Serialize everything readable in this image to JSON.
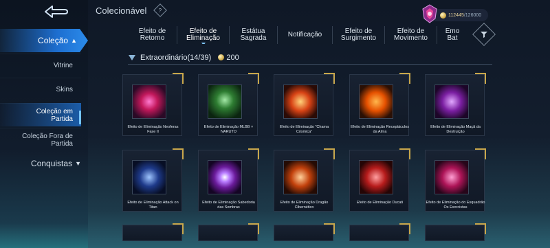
{
  "header": {
    "back_icon": "back-arrow-icon",
    "title": "Colecionável",
    "help_icon": "help-question-icon",
    "currency_current": "112445",
    "currency_max": "/126000"
  },
  "sidebar": {
    "main": "Coleção",
    "items": [
      {
        "label": "Vitrine"
      },
      {
        "label": "Skins"
      },
      {
        "label": "Coleção em Partida"
      },
      {
        "label": "Coleção Fora de Partida"
      }
    ],
    "conquistas": "Conquistas"
  },
  "tabs": [
    {
      "label": "Efeito de Retorno"
    },
    {
      "label": "Efeito de Eliminação"
    },
    {
      "label": "Estátua Sagrada"
    },
    {
      "label": "Notificação"
    },
    {
      "label": "Efeito de Surgimento"
    },
    {
      "label": "Efeito de Movimento"
    },
    {
      "label": "Emo Bat"
    }
  ],
  "section": {
    "title": "Extraordinário(14/39)",
    "price": "200"
  },
  "cards": [
    {
      "label": "Efeito de Eliminação Neoferas Fase II",
      "color": "#c2185b"
    },
    {
      "label": "Efeito de Eliminação MLBB × NARUTO",
      "color": "#2e7d32"
    },
    {
      "label": "Efeito de Eliminação \"Chama Cósmica\"",
      "color": "#d84315"
    },
    {
      "label": "Efeito de Eliminação Receptáculos da Alma",
      "color": "#e65100"
    },
    {
      "label": "Efeito de Eliminação Maçã da Destruição",
      "color": "#7b1fa2"
    },
    {
      "label": "Efeito de Eliminação Attack on Titan",
      "color": "#1e3a8a"
    },
    {
      "label": "Efeito de Eliminação Sabedoria das Sombras",
      "color": "#6a1b9a"
    },
    {
      "label": "Efeito de Eliminação Dragão Cibernético",
      "color": "#c2410c"
    },
    {
      "label": "Efeito de Eliminação Ducati",
      "color": "#b71c1c"
    },
    {
      "label": "Efeito de Eliminação do Esquadrão Os Exorcistas",
      "color": "#ad1457"
    }
  ]
}
